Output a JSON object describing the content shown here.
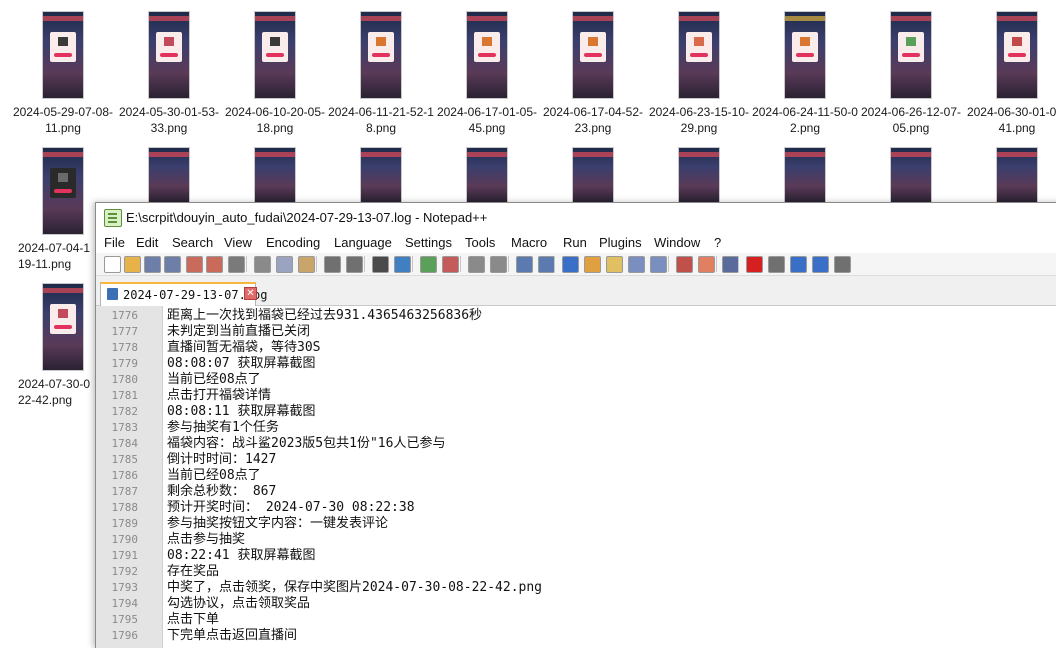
{
  "explorer": {
    "row1": [
      "2024-05-29-07-08-11.png",
      "2024-05-30-01-53-33.png",
      "2024-06-10-20-05-18.png",
      "2024-06-11-21-52-18.png",
      "2024-06-17-01-05-45.png",
      "2024-06-17-04-52-23.png",
      "2024-06-23-15-10-29.png",
      "2024-06-24-11-50-02.png",
      "2024-06-26-12-07-05.png",
      "2024-06-30-01-01-41.png"
    ],
    "row2": [
      "2024-07-04-1 19-11.png"
    ],
    "row3": [
      "2024-07-30-0 22-42.png"
    ]
  },
  "window": {
    "title": "E:\\scrpit\\douyin_auto_fudai\\2024-07-29-13-07.log - Notepad++"
  },
  "menu": [
    "File",
    "Edit",
    "Search",
    "View",
    "Encoding",
    "Language",
    "Settings",
    "Tools",
    "Macro",
    "Run",
    "Plugins",
    "Window",
    "?"
  ],
  "toolbar_icons": [
    {
      "name": "new-file-icon",
      "color": "#ffffff"
    },
    {
      "name": "open-file-icon",
      "color": "#e8b24a"
    },
    {
      "name": "save-icon",
      "color": "#6d7fa8"
    },
    {
      "name": "save-all-icon",
      "color": "#6d7fa8"
    },
    {
      "name": "close-icon",
      "color": "#c96a5a"
    },
    {
      "name": "close-all-icon",
      "color": "#c96a5a"
    },
    {
      "name": "print-icon",
      "color": "#7a7a7a"
    },
    {
      "name": "cut-icon",
      "color": "#8a8a8a"
    },
    {
      "name": "copy-icon",
      "color": "#9aa3c0"
    },
    {
      "name": "paste-icon",
      "color": "#c9a46b"
    },
    {
      "name": "undo-icon",
      "color": "#707070"
    },
    {
      "name": "redo-icon",
      "color": "#707070"
    },
    {
      "name": "find-icon",
      "color": "#4a4a4a"
    },
    {
      "name": "replace-icon",
      "color": "#3f7fc2"
    },
    {
      "name": "zoom-in-icon",
      "color": "#5aa05a"
    },
    {
      "name": "zoom-out-icon",
      "color": "#c55a5a"
    },
    {
      "name": "sync-vertical-icon",
      "color": "#8a8a8a"
    },
    {
      "name": "sync-horizontal-icon",
      "color": "#8a8a8a"
    },
    {
      "name": "word-wrap-icon",
      "color": "#5a7ab0"
    },
    {
      "name": "show-all-chars-icon",
      "color": "#5a7ab0"
    },
    {
      "name": "indent-guide-icon",
      "color": "#3a6fc8"
    },
    {
      "name": "user-language-icon",
      "color": "#e0a040"
    },
    {
      "name": "doc-map-icon",
      "color": "#e0c060"
    },
    {
      "name": "function-list-icon",
      "color": "#7a8fc0"
    },
    {
      "name": "clipboard-history-icon",
      "color": "#7a8fc0"
    },
    {
      "name": "folder-workspace-icon",
      "color": "#c0504a"
    },
    {
      "name": "project-panel-icon",
      "color": "#e08060"
    },
    {
      "name": "monitoring-icon",
      "color": "#5a6a9a"
    },
    {
      "name": "record-macro-icon",
      "color": "#d62020"
    },
    {
      "name": "stop-macro-icon",
      "color": "#707070"
    },
    {
      "name": "play-macro-icon",
      "color": "#3a6fc8"
    },
    {
      "name": "run-macro-multiple-icon",
      "color": "#3a6fc8"
    },
    {
      "name": "save-macro-icon",
      "color": "#707070"
    }
  ],
  "tab": {
    "label": "2024-07-29-13-07.log"
  },
  "editor": {
    "lines": [
      {
        "n": "1776",
        "t": "距离上一次找到福袋已经过去931.4365463256836秒"
      },
      {
        "n": "1777",
        "t": "未判定到当前直播已关闭"
      },
      {
        "n": "1778",
        "t": "直播间暂无福袋，等待30S"
      },
      {
        "n": "1779",
        "t": "08:08:07 获取屏幕截图"
      },
      {
        "n": "1780",
        "t": "当前已经08点了"
      },
      {
        "n": "1781",
        "t": "点击打开福袋详情"
      },
      {
        "n": "1782",
        "t": "08:08:11 获取屏幕截图"
      },
      {
        "n": "1783",
        "t": "参与抽奖有1个任务"
      },
      {
        "n": "1784",
        "t": "福袋内容：战斗鲨2023版5包共1份\"16人已参与"
      },
      {
        "n": "1785",
        "t": "倒计时时间：1427"
      },
      {
        "n": "1786",
        "t": "当前已经08点了"
      },
      {
        "n": "1787",
        "t": "剩余总秒数：  867"
      },
      {
        "n": "1788",
        "t": "预计开奖时间：  2024-07-30 08:22:38"
      },
      {
        "n": "1789",
        "t": "参与抽奖按钮文字内容：一键发表评论"
      },
      {
        "n": "1790",
        "t": "点击参与抽奖"
      },
      {
        "n": "1791",
        "t": "08:22:41 获取屏幕截图"
      },
      {
        "n": "1792",
        "t": "存在奖品"
      },
      {
        "n": "1793",
        "t": "中奖了，点击领奖，保存中奖图片2024-07-30-08-22-42.png"
      },
      {
        "n": "1794",
        "t": "勾选协议，点击领取奖品"
      },
      {
        "n": "1795",
        "t": "点击下单"
      },
      {
        "n": "1796",
        "t": "下完单点击返回直播间"
      }
    ]
  }
}
